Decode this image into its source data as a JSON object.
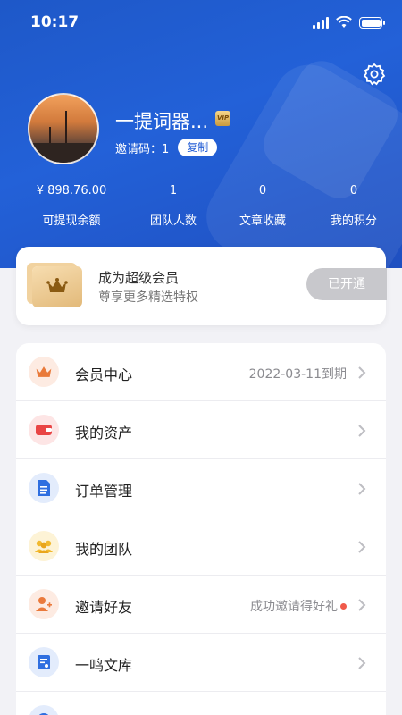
{
  "status": {
    "time": "10:17"
  },
  "profile": {
    "name": "一提词器...",
    "vip_text": "VIP",
    "invite_label": "邀请码：",
    "invite_code": "1",
    "copy_label": "复制"
  },
  "stats": [
    {
      "value": "¥ 898.76.00",
      "label": "可提现余额"
    },
    {
      "value": "1",
      "label": "团队人数"
    },
    {
      "value": "0",
      "label": "文章收藏"
    },
    {
      "value": "0",
      "label": "我的积分"
    }
  ],
  "member": {
    "title": "成为超级会员",
    "subtitle": "尊享更多精选特权",
    "button": "已开通"
  },
  "menu": [
    {
      "label": "会员中心",
      "right": "2022-03-11到期",
      "icon": "crown-icon"
    },
    {
      "label": "我的资产",
      "right": "",
      "icon": "wallet-icon"
    },
    {
      "label": "订单管理",
      "right": "",
      "icon": "document-icon"
    },
    {
      "label": "我的团队",
      "right": "",
      "icon": "team-icon"
    },
    {
      "label": "邀请好友",
      "right": "成功邀请得好礼",
      "icon": "add-user-icon"
    },
    {
      "label": "一鸣文库",
      "right": "",
      "icon": "library-icon"
    },
    {
      "label": "",
      "right": "",
      "icon": "globe-icon"
    }
  ],
  "colors": {
    "primary": "#2361d8",
    "accent_red": "#f05a4a",
    "gold": "#e2b979"
  }
}
